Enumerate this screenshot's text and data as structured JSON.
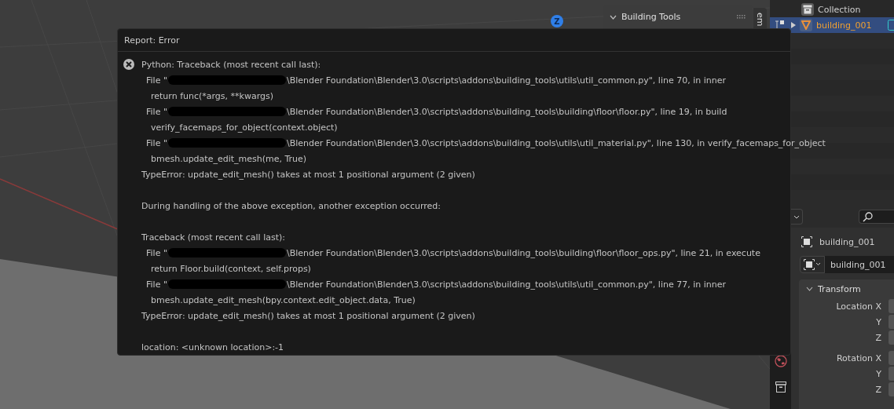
{
  "viewport": {
    "gizmo": "Z",
    "sidebar_panel": {
      "title": "Building Tools",
      "expanded": true
    },
    "sidebar_tab": "em"
  },
  "outliner": {
    "rows": [
      {
        "kind": "collection",
        "name": "Collection",
        "selected": false
      },
      {
        "kind": "object",
        "name": "building_001",
        "selected": true,
        "expanded": false
      }
    ]
  },
  "properties": {
    "object_name": "building_001",
    "name_field": "building_001",
    "transform": {
      "title": "Transform",
      "expanded": true,
      "rows": [
        "Location X",
        "Y",
        "Z",
        "Rotation X",
        "Y",
        "Z"
      ]
    }
  },
  "report": {
    "title": "Report: Error",
    "lines": [
      {
        "kind": "heading",
        "text": "Python: Traceback (most recent call last):"
      },
      {
        "kind": "file",
        "prefix": "File \"",
        "text": "\\Blender Foundation\\Blender\\3.0\\scripts\\addons\\building_tools\\utils\\util_common.py\", line 70, in inner"
      },
      {
        "kind": "code",
        "text": "return func(*args, **kwargs)"
      },
      {
        "kind": "file",
        "prefix": "File \"",
        "text": "\\Blender Foundation\\Blender\\3.0\\scripts\\addons\\building_tools\\building\\floor\\floor.py\", line 19, in build"
      },
      {
        "kind": "code",
        "text": "verify_facemaps_for_object(context.object)"
      },
      {
        "kind": "file",
        "prefix": "File \"",
        "text": "\\Blender Foundation\\Blender\\3.0\\scripts\\addons\\building_tools\\utils\\util_material.py\", line 130, in verify_facemaps_for_object"
      },
      {
        "kind": "code",
        "text": "bmesh.update_edit_mesh(me, True)"
      },
      {
        "kind": "heading",
        "text": "TypeError: update_edit_mesh() takes at most 1 positional argument (2 given)"
      },
      {
        "kind": "blank"
      },
      {
        "kind": "heading",
        "text": "During handling of the above exception, another exception occurred:"
      },
      {
        "kind": "blank"
      },
      {
        "kind": "heading",
        "text": "Traceback (most recent call last):"
      },
      {
        "kind": "file",
        "prefix": "File \"",
        "text": "\\Blender Foundation\\Blender\\3.0\\scripts\\addons\\building_tools\\building\\floor\\floor_ops.py\", line 21, in execute"
      },
      {
        "kind": "code",
        "text": "return Floor.build(context, self.props)"
      },
      {
        "kind": "file",
        "prefix": "File \"",
        "text": "\\Blender Foundation\\Blender\\3.0\\scripts\\addons\\building_tools\\utils\\util_common.py\", line 77, in inner"
      },
      {
        "kind": "code",
        "text": "bmesh.update_edit_mesh(bpy.context.edit_object.data, True)"
      },
      {
        "kind": "heading",
        "text": "TypeError: update_edit_mesh() takes at most 1 positional argument (2 given)"
      },
      {
        "kind": "blank"
      },
      {
        "kind": "heading",
        "text": "location: <unknown location>:-1"
      }
    ]
  }
}
